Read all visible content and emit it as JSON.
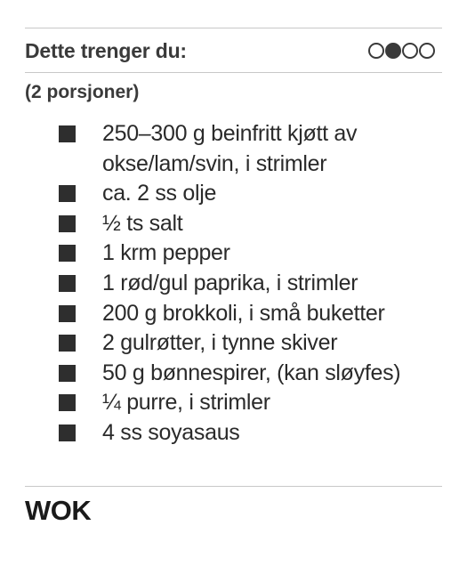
{
  "header": {
    "title": "Dette trenger du:",
    "difficulty_level": 2,
    "difficulty_max": 4
  },
  "servings": "(2 porsjoner)",
  "ingredients": [
    "250–300 g beinfritt kjøtt av okse/lam/svin, i strimler",
    "ca. 2 ss olje",
    "½ ts salt",
    "1 krm pepper",
    "1 rød/gul paprika, i strimler",
    "200 g brokkoli, i små buketter",
    "2 gulrøtter, i tynne skiver",
    "50 g bønnespirer, (kan sløyfes)",
    "¼ purre, i strimler",
    "4 ss soyasaus"
  ],
  "recipe_title": "WOK"
}
